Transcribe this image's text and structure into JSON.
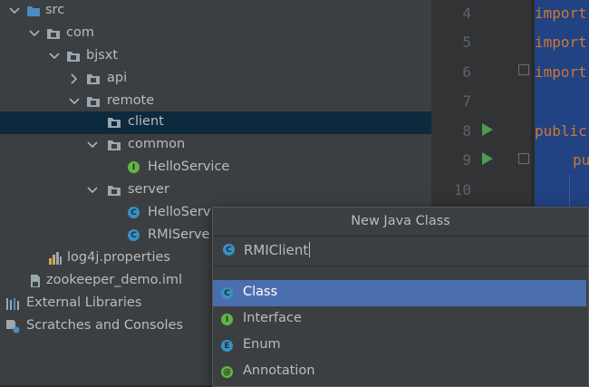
{
  "tree": {
    "items": [
      {
        "label": "src",
        "kind": "folder-src",
        "arrow": "down"
      },
      {
        "label": "com",
        "kind": "package",
        "arrow": "down"
      },
      {
        "label": "bjsxt",
        "kind": "package",
        "arrow": "down"
      },
      {
        "label": "api",
        "kind": "package",
        "arrow": "right"
      },
      {
        "label": "remote",
        "kind": "package",
        "arrow": "down"
      },
      {
        "label": "client",
        "kind": "package",
        "arrow": "none",
        "selected": true
      },
      {
        "label": "common",
        "kind": "package",
        "arrow": "down"
      },
      {
        "label": "HelloService",
        "kind": "interface"
      },
      {
        "label": "server",
        "kind": "package",
        "arrow": "down"
      },
      {
        "label": "HelloServ",
        "kind": "class"
      },
      {
        "label": "RMIServe",
        "kind": "class-run"
      },
      {
        "label": "log4j.properties",
        "kind": "properties"
      },
      {
        "label": "zookeeper_demo.iml",
        "kind": "iml"
      },
      {
        "label": "External Libraries",
        "kind": "libraries"
      },
      {
        "label": "Scratches and Consoles",
        "kind": "scratches"
      }
    ]
  },
  "editor": {
    "line_numbers": [
      "4",
      "5",
      "6",
      "7",
      "8",
      "9",
      "10"
    ],
    "code_fragments": [
      "import",
      "import",
      "import",
      "public",
      "pu"
    ]
  },
  "dialog": {
    "title": "New Java Class",
    "input_value": "RMIClient",
    "options": [
      {
        "label": "Class",
        "icon": "class-icon",
        "selected": true
      },
      {
        "label": "Interface",
        "icon": "interface-icon"
      },
      {
        "label": "Enum",
        "icon": "enum-icon"
      },
      {
        "label": "Annotation",
        "icon": "annotation-icon"
      }
    ]
  },
  "colors": {
    "tree_bg": "#3c3f41",
    "selection_bg": "#0d293e",
    "dialog_selected": "#4b6eaf",
    "keyword": "#cc7832",
    "run_green": "#499c54"
  }
}
